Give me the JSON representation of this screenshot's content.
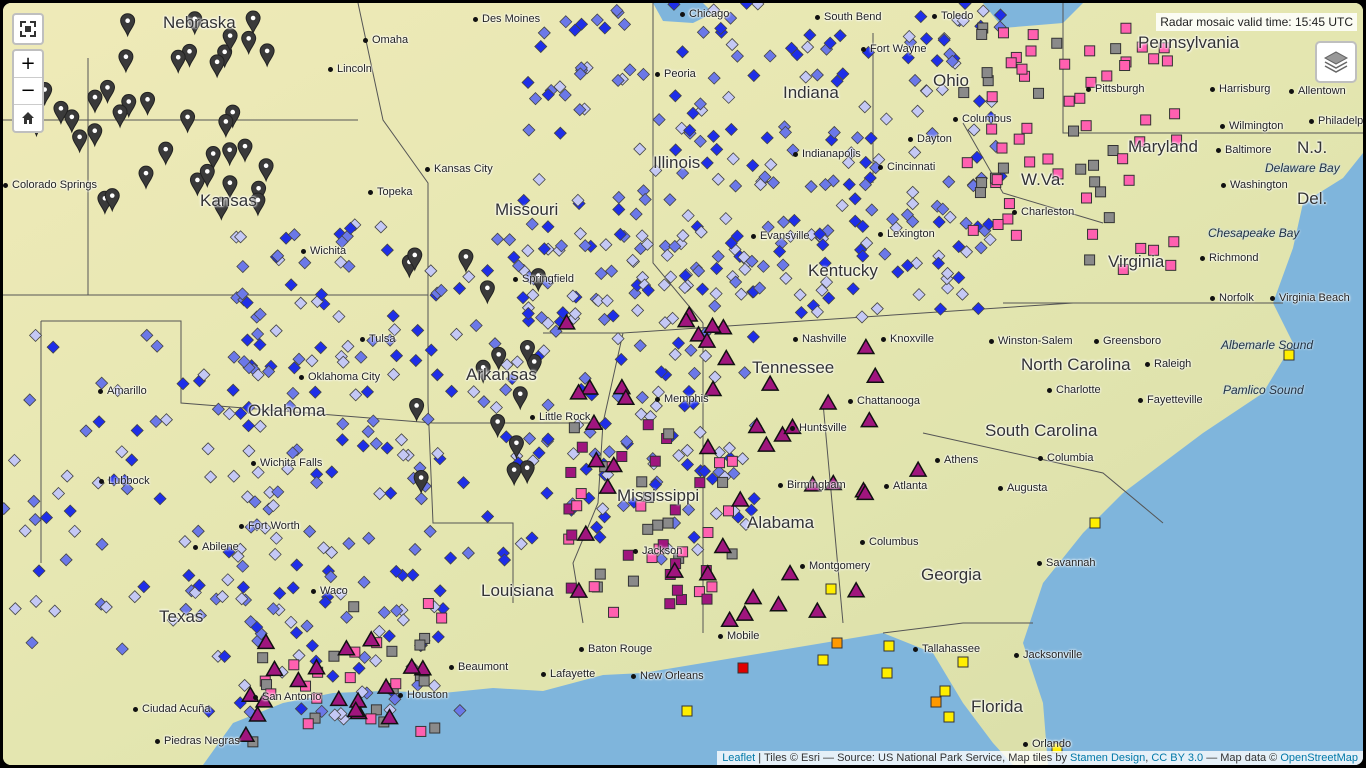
{
  "map": {
    "valid_time_label": "Radar mosaic valid time:",
    "valid_time_value": "15:45 UTC",
    "zoom_in": "+",
    "zoom_out": "−",
    "fullscreen_icon": "fullscreen-icon",
    "home_icon": "home-icon",
    "layers_icon": "layers-icon",
    "colors": {
      "land": "#e9e6b4",
      "water": "#7fb5dc",
      "border": "#555555",
      "blue_dark": "#1e2ee8",
      "blue_mid": "#6b78e8",
      "blue_light": "#c4c8f5",
      "magenta": "#a0157e",
      "pink": "#ff60b0",
      "gray": "#8a8a8a",
      "pin": "#3a3a3a",
      "yellow": "#ffee00",
      "orange": "#ff9900",
      "red": "#e00000"
    }
  },
  "labels": {
    "states": [
      "Nebraska",
      "Kansas",
      "Missouri",
      "Oklahoma",
      "Arkansas",
      "Texas",
      "Louisiana",
      "Mississippi",
      "Alabama",
      "Georgia",
      "Florida",
      "Tennessee",
      "Kentucky",
      "South Carolina",
      "North Carolina",
      "Virginia",
      "W.Va.",
      "Ohio",
      "Pennsylvania",
      "Maryland",
      "Del.",
      "N.J.",
      "Indiana",
      "Illinois"
    ],
    "cities": [
      "Des Moines",
      "Omaha",
      "Lincoln",
      "Kansas City",
      "Topeka",
      "Wichita",
      "Springfield",
      "Tulsa",
      "Oklahoma City",
      "Amarillo",
      "Lubbock",
      "Wichita Falls",
      "Fort Worth",
      "Abilene",
      "Waco",
      "San Antonio",
      "Houston",
      "Beaumont",
      "Lafayette",
      "Baton Rouge",
      "New Orleans",
      "Mobile",
      "Ciudad Acuña",
      "Piedras Negras",
      "Little Rock",
      "Memphis",
      "Jackson",
      "Birmingham",
      "Huntsville",
      "Montgomery",
      "Columbus",
      "Atlanta",
      "Athens",
      "Augusta",
      "Columbia",
      "Savannah",
      "Jacksonville",
      "Tallahassee",
      "Orlando",
      "Chattanooga",
      "Knoxville",
      "Nashville",
      "Evansville",
      "Lexington",
      "Cincinnati",
      "Dayton",
      "Fort Wayne",
      "Indianapolis",
      "Peoria",
      "Chicago",
      "South Bend",
      "Toledo",
      "Columbus",
      "Pittsburgh",
      "Harrisburg",
      "Allentown",
      "Philadelphia",
      "Wilmington",
      "Baltimore",
      "Washington",
      "Charleston",
      "Richmond",
      "Norfolk",
      "Virginia Beach",
      "Winston-Salem",
      "Greensboro",
      "Raleigh",
      "Charlotte",
      "Fayetteville",
      "Colorado Springs"
    ],
    "water": [
      "Delaware Bay",
      "Chesapeake Bay",
      "Albemarle Sound",
      "Pamlico Sound"
    ]
  },
  "attribution": {
    "leaflet": "Leaflet",
    "text1": " | Tiles © Esri — Source: US National Park Service, Map tiles by ",
    "stamen": "Stamen Design",
    "sep": ", ",
    "cc": "CC BY 3.0",
    "text2": " — Map data © ",
    "osm": "OpenStreetMap"
  }
}
